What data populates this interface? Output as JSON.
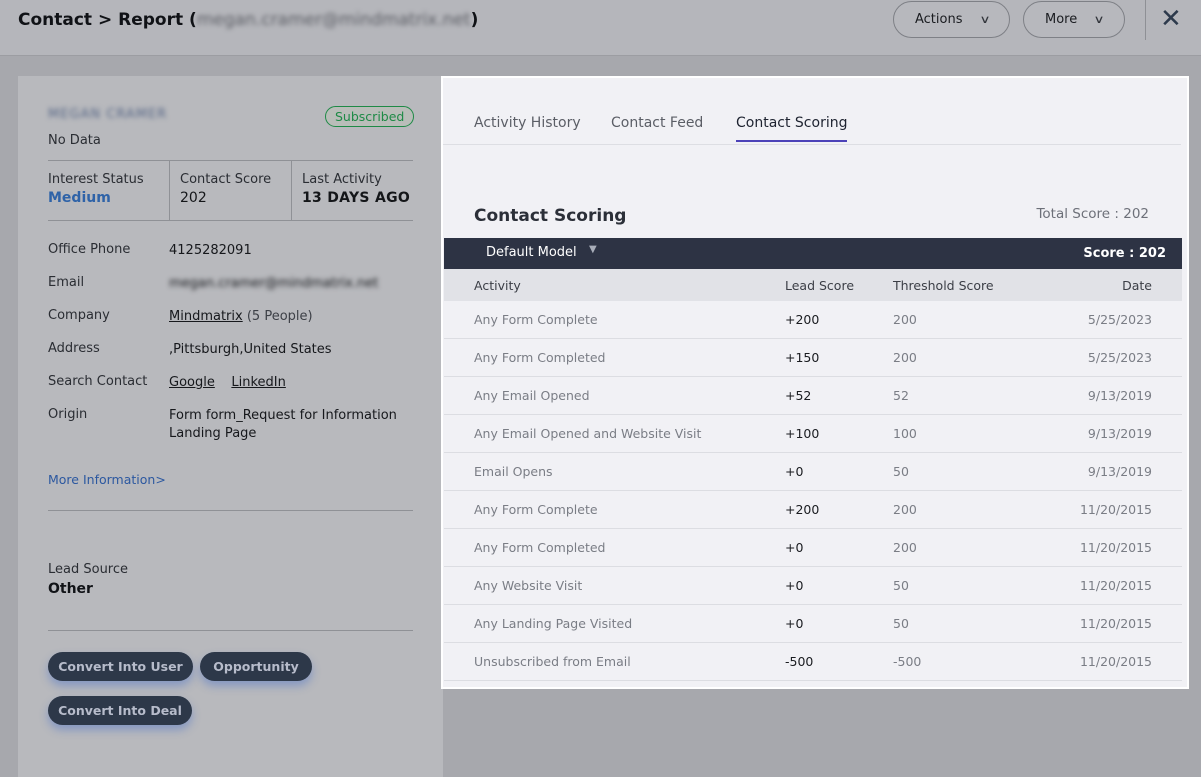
{
  "header": {
    "title_prefix": "Contact > Report (",
    "title_email": "megan.cramer@mindmatrix.net",
    "title_suffix": ")",
    "actions_label": "Actions",
    "more_label": "More",
    "close_icon": "close-icon"
  },
  "contact": {
    "name": "MEGAN CRAMER",
    "status_badge": "Subscribed",
    "subtitle": "No Data",
    "stats": [
      {
        "label": "Interest Status",
        "value": "Medium"
      },
      {
        "label": "Contact Score",
        "value": "202"
      },
      {
        "label": "Last Activity",
        "value": "13 DAYS AGO"
      }
    ],
    "fields": {
      "office_phone_label": "Office Phone",
      "office_phone": "4125282091",
      "email_label": "Email",
      "email": "megan.cramer@mindmatrix.net",
      "company_label": "Company",
      "company": "Mindmatrix",
      "company_people": "(5 People)",
      "address_label": "Address",
      "address": ",Pittsburgh,United States",
      "search_label": "Search Contact",
      "search_google": "Google",
      "search_linkedin": "LinkedIn",
      "origin_label": "Origin",
      "origin": "Form form_Request for Information Landing Page"
    },
    "more_info": "More Information>",
    "lead_source_label": "Lead Source",
    "lead_source": "Other",
    "buttons": {
      "convert_user": "Convert Into User",
      "opportunity": "Opportunity",
      "convert_deal": "Convert Into Deal"
    }
  },
  "tabs": [
    {
      "label": "Activity History",
      "active": false
    },
    {
      "label": "Contact Feed",
      "active": false
    },
    {
      "label": "Contact Scoring",
      "active": true
    }
  ],
  "scoring": {
    "title": "Contact Scoring",
    "total": "Total Score : 202",
    "model": "Default Model",
    "score": "Score : 202",
    "columns": [
      "Activity",
      "Lead Score",
      "Threshold Score",
      "Date"
    ],
    "rows": [
      {
        "activity": "Any Form Complete",
        "lead": "+200",
        "threshold": "200",
        "date": "5/25/2023"
      },
      {
        "activity": "Any Form Completed",
        "lead": "+150",
        "threshold": "200",
        "date": "5/25/2023"
      },
      {
        "activity": "Any Email Opened",
        "lead": "+52",
        "threshold": "52",
        "date": "9/13/2019"
      },
      {
        "activity": "Any Email Opened and Website Visit",
        "lead": "+100",
        "threshold": "100",
        "date": "9/13/2019"
      },
      {
        "activity": "Email Opens",
        "lead": "+0",
        "threshold": "50",
        "date": "9/13/2019"
      },
      {
        "activity": "Any Form Complete",
        "lead": "+200",
        "threshold": "200",
        "date": "11/20/2015"
      },
      {
        "activity": "Any Form Completed",
        "lead": "+0",
        "threshold": "200",
        "date": "11/20/2015"
      },
      {
        "activity": "Any Website Visit",
        "lead": "+0",
        "threshold": "50",
        "date": "11/20/2015"
      },
      {
        "activity": "Any Landing Page Visited",
        "lead": "+0",
        "threshold": "50",
        "date": "11/20/2015"
      },
      {
        "activity": "Unsubscribed from Email",
        "lead": "-500",
        "threshold": "-500",
        "date": "11/20/2015"
      }
    ]
  },
  "colors": {
    "accent_tab": "#4c42b8",
    "subscribed": "#1e8a46",
    "dark_button": "#2d3849",
    "model_bar": "#2d3344"
  }
}
